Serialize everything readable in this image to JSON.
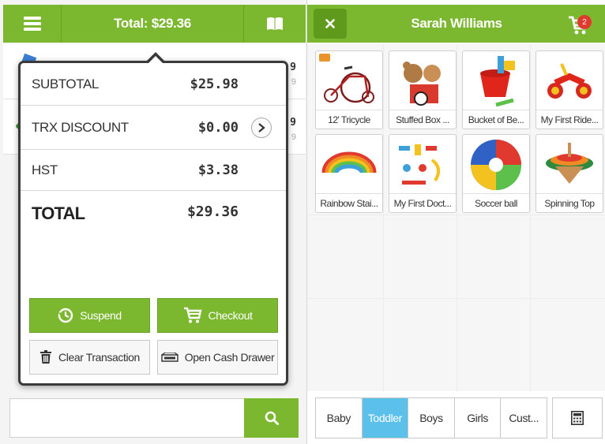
{
  "left_header": {
    "total_label": "Total: $29.36"
  },
  "cart_rows": [
    {
      "price": "9",
      "price_sub": "9"
    },
    {
      "price": "9",
      "price_sub": "9"
    }
  ],
  "summary": {
    "subtotal_label": "SUBTOTAL",
    "subtotal_value": "$25.98",
    "discount_label": "TRX DISCOUNT",
    "discount_value": "$0.00",
    "tax_label": "HST",
    "tax_value": "$3.38",
    "total_label": "TOTAL",
    "total_value": "$29.36"
  },
  "actions": {
    "suspend": "Suspend",
    "checkout": "Checkout",
    "clear": "Clear Transaction",
    "open_drawer": "Open Cash Drawer"
  },
  "search": {
    "placeholder": ""
  },
  "right_header": {
    "customer_name": "Sarah Williams",
    "cart_count": "2"
  },
  "products": [
    {
      "name": "12' Tricycle"
    },
    {
      "name": "Stuffed Box ..."
    },
    {
      "name": "Bucket of Be..."
    },
    {
      "name": "My First Ride..."
    },
    {
      "name": "Rainbow Stai..."
    },
    {
      "name": "My First Doct..."
    },
    {
      "name": "Soccer ball"
    },
    {
      "name": "Spinning Top"
    }
  ],
  "categories": [
    {
      "label": "Baby"
    },
    {
      "label": "Toddler"
    },
    {
      "label": "Boys"
    },
    {
      "label": "Girls"
    },
    {
      "label": "Cust..."
    }
  ],
  "colors": {
    "brand_green": "#7cb82f",
    "active_tab": "#5bc0ea",
    "badge_red": "#e03a2e"
  }
}
